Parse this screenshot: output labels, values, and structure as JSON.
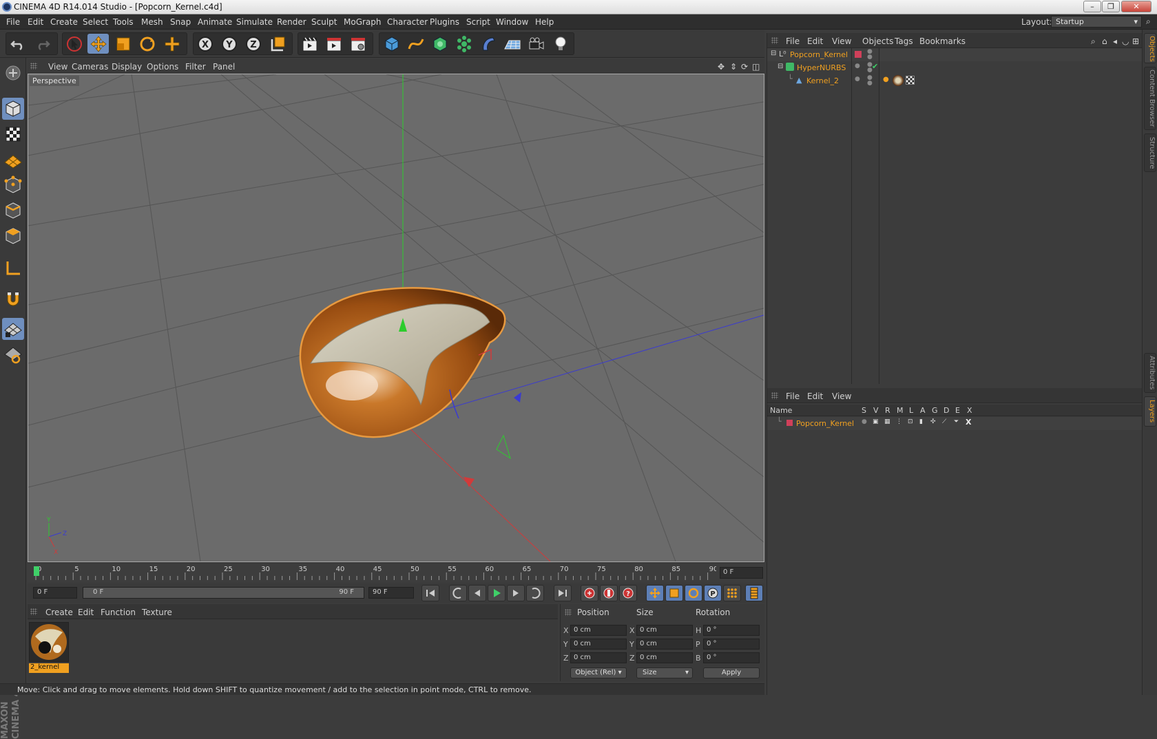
{
  "window": {
    "title": "CINEMA 4D R14.014 Studio - [Popcorn_Kernel.c4d]"
  },
  "menubar": {
    "items": [
      "File",
      "Edit",
      "Create",
      "Select",
      "Tools",
      "Mesh",
      "Snap",
      "Animate",
      "Simulate",
      "Render",
      "Sculpt",
      "MoGraph",
      "Character",
      "Plugins",
      "Script",
      "Window",
      "Help"
    ],
    "layout_label": "Layout:",
    "layout_value": "Startup"
  },
  "toolbar": {
    "axis_x": "X",
    "axis_y": "Y",
    "axis_z": "Z",
    "active_tool": "move"
  },
  "viewport": {
    "menu": [
      "View",
      "Cameras",
      "Display",
      "Options",
      "Filter",
      "Panel"
    ],
    "label": "Perspective",
    "axis_labels": {
      "x": "X",
      "y": "Y",
      "z": "Z"
    }
  },
  "timeline": {
    "ticks": [
      "0",
      "5",
      "10",
      "15",
      "20",
      "25",
      "30",
      "35",
      "40",
      "45",
      "50",
      "55",
      "60",
      "65",
      "70",
      "75",
      "80",
      "85",
      "90"
    ],
    "current_frame": "0 F",
    "start_frame": "0 F",
    "range_start": "0 F",
    "range_end": "90 F",
    "end_frame": "90 F"
  },
  "material_panel": {
    "menu": [
      "Create",
      "Edit",
      "Function",
      "Texture"
    ],
    "materials": [
      {
        "name": "2_kernel"
      }
    ]
  },
  "coords": {
    "headers": {
      "position": "Position",
      "size": "Size",
      "rotation": "Rotation"
    },
    "axis_pos": [
      "X",
      "Y",
      "Z"
    ],
    "axis_rot": [
      "H",
      "P",
      "B"
    ],
    "position": [
      "0 cm",
      "0 cm",
      "0 cm"
    ],
    "size": [
      "0 cm",
      "0 cm",
      "0 cm"
    ],
    "rotation": [
      "0 °",
      "0 °",
      "0 °"
    ],
    "mode": "Object (Rel)",
    "size_mode": "Size",
    "apply_label": "Apply"
  },
  "status": {
    "text": "Move: Click and drag to move elements. Hold down SHIFT to quantize movement / add to the selection in point mode, CTRL to remove."
  },
  "object_manager": {
    "menu": [
      "File",
      "Edit",
      "View",
      "Objects",
      "Tags",
      "Bookmarks"
    ],
    "objects": [
      {
        "name": "Popcorn_Kernel",
        "level": 0
      },
      {
        "name": "HyperNURBS",
        "level": 1
      },
      {
        "name": "Kernel_2",
        "level": 2
      }
    ]
  },
  "layer_manager": {
    "menu": [
      "File",
      "Edit",
      "View"
    ],
    "columns": [
      "Name",
      "S",
      "V",
      "R",
      "M",
      "L",
      "A",
      "G",
      "D",
      "E",
      "X"
    ],
    "layers": [
      {
        "name": "Popcorn_Kernel"
      }
    ]
  },
  "side_tabs": {
    "top": [
      "Objects",
      "Content Browser",
      "Structure"
    ],
    "bottom": [
      "Attributes",
      "Layers"
    ]
  },
  "colors": {
    "accent": "#f0a020",
    "selection": "#6f8fbf",
    "viewport_bg": "#6b6b6b"
  }
}
